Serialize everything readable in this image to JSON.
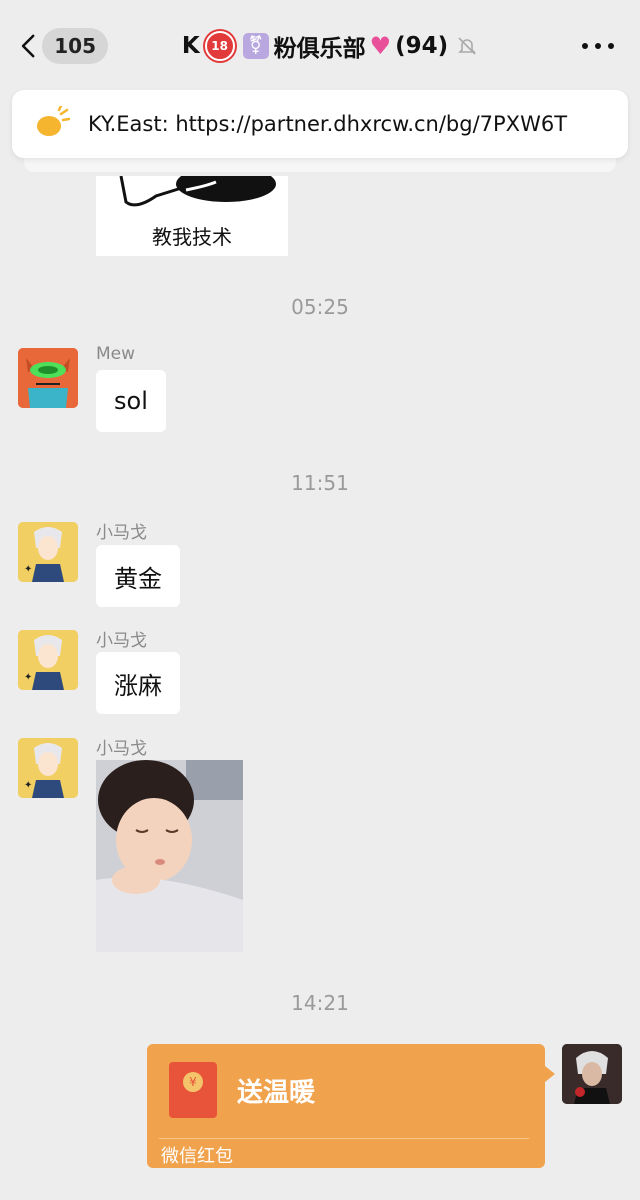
{
  "header": {
    "unread_count": "105",
    "title_prefix": "K",
    "title_main": "粉俱乐部",
    "member_count": "(94)"
  },
  "pinned": {
    "text": "KY.East: https://partner.dhxrcw.cn/bg/7PXW6T"
  },
  "messages": [
    {
      "type": "sticker",
      "caption": "教我技术"
    },
    {
      "type": "time",
      "text": "05:25"
    },
    {
      "type": "text",
      "sender": "Mew",
      "text": "sol"
    },
    {
      "type": "time",
      "text": "11:51"
    },
    {
      "type": "text",
      "sender": "小马戈",
      "text": "黄金"
    },
    {
      "type": "text",
      "sender": "小马戈",
      "text": "涨麻"
    },
    {
      "type": "image",
      "sender": "小马戈"
    },
    {
      "type": "time",
      "text": "14:21"
    },
    {
      "type": "red_packet",
      "title": "送温暖",
      "label": "微信红包"
    }
  ],
  "icons": {
    "back": "chevron-left-icon",
    "mute": "bell-slash-icon",
    "more": "more-dots-icon",
    "pinned": "speaker-icon"
  },
  "colors": {
    "background": "#ededed",
    "red_packet": "#f0a24c",
    "timestamp": "#9a9a9a"
  }
}
